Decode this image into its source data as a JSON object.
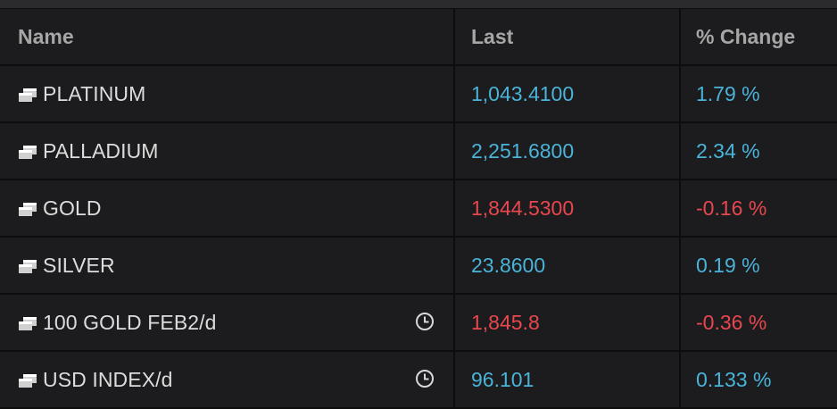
{
  "table": {
    "headers": {
      "name": "Name",
      "last": "Last",
      "change": "% Change"
    },
    "rows": [
      {
        "name": "PLATINUM",
        "last": "1,043.4100",
        "change": "1.79 %",
        "direction": "up",
        "delayed": false
      },
      {
        "name": "PALLADIUM",
        "last": "2,251.6800",
        "change": "2.34 %",
        "direction": "up",
        "delayed": false
      },
      {
        "name": "GOLD",
        "last": "1,844.5300",
        "change": "-0.16 %",
        "direction": "down",
        "delayed": false
      },
      {
        "name": "SILVER",
        "last": "23.8600",
        "change": "0.19 %",
        "direction": "up",
        "delayed": false
      },
      {
        "name": "100 GOLD FEB2/d",
        "last": "1,845.8",
        "change": "-0.36 %",
        "direction": "down",
        "delayed": true
      },
      {
        "name": "USD INDEX/d",
        "last": "96.101",
        "change": "0.133 %",
        "direction": "up",
        "delayed": true
      }
    ]
  },
  "colors": {
    "up": "#4ab3d8",
    "down": "#e8474f",
    "background": "#1c1c1e",
    "grid": "#0d0d0d"
  },
  "icons": {
    "symbol": "window-stack-icon",
    "delayed": "clock-icon"
  }
}
